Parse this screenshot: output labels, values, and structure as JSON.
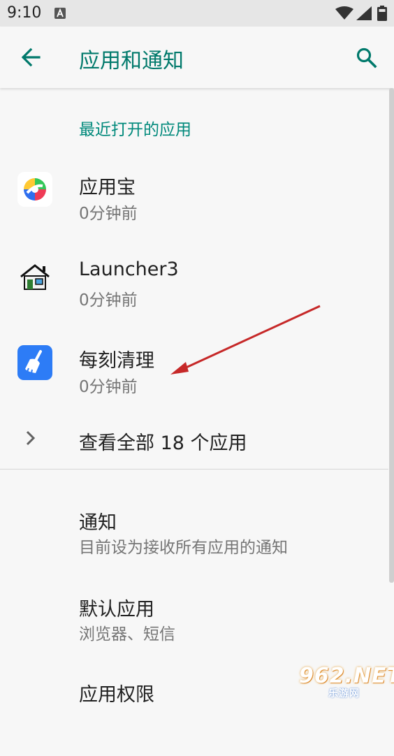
{
  "status_bar": {
    "time": "9:10"
  },
  "app_bar": {
    "title": "应用和通知"
  },
  "recent_section": {
    "header": "最近打开的应用",
    "apps": [
      {
        "name": "应用宝",
        "time": "0分钟前",
        "icon": "yingyongbao-icon"
      },
      {
        "name": "Launcher3",
        "time": "0分钟前",
        "icon": "house-icon"
      },
      {
        "name": "每刻清理",
        "time": "0分钟前",
        "icon": "broom-icon"
      }
    ],
    "see_all": "查看全部 18 个应用"
  },
  "prefs": [
    {
      "title": "通知",
      "summary": "目前设为接收所有应用的通知"
    },
    {
      "title": "默认应用",
      "summary": "浏览器、短信"
    },
    {
      "title": "应用权限",
      "summary": ""
    }
  ],
  "watermark": {
    "main": "962.NET",
    "sub": "乐游网"
  },
  "colors": {
    "accent": "#00897b",
    "annotation_arrow": "#c62828"
  }
}
